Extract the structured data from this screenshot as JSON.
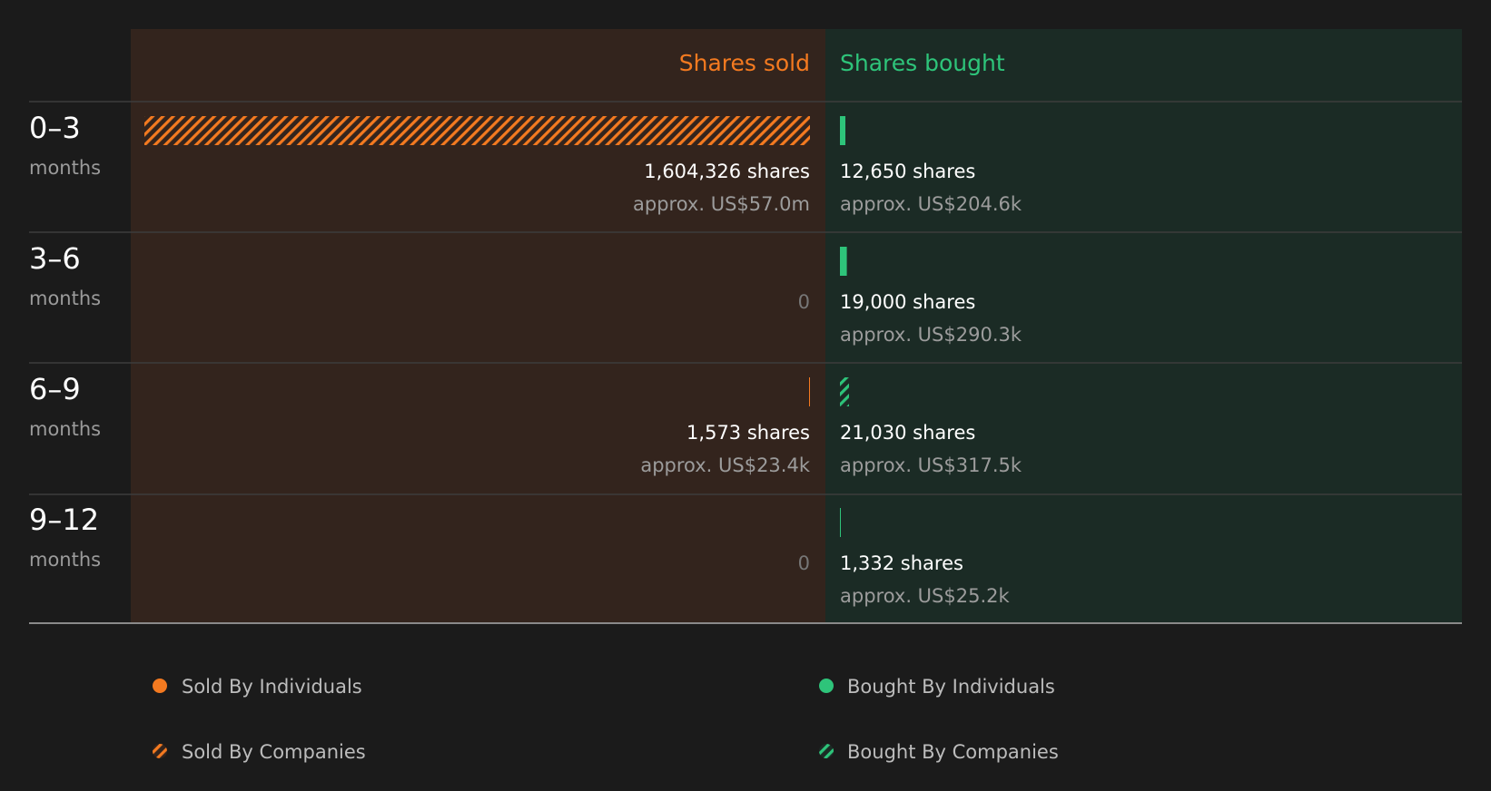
{
  "colors": {
    "background": "#1b1b1b",
    "sold_panel": "#33241d",
    "bought_panel": "#1b2b25",
    "sold_accent": "#f47a20",
    "bought_accent": "#2ec47a",
    "divider": "#3d3d3d",
    "baseline": "#8a8a8a"
  },
  "chart_data": {
    "type": "bar",
    "orientation": "horizontal-diverging",
    "headers": {
      "sold": "Shares sold",
      "bought": "Shares bought"
    },
    "unit_label": "months",
    "sold_scale_max": 1604326,
    "rows": [
      {
        "range": "0–3",
        "sold": {
          "by": "companies",
          "shares": 1604326,
          "shares_label": "1,604,326 shares",
          "approx_label": "approx. US$57.0m",
          "zero_label": ""
        },
        "bought": {
          "by": "individuals",
          "shares": 12650,
          "shares_label": "12,650 shares",
          "approx_label": "approx. US$204.6k",
          "zero_label": ""
        }
      },
      {
        "range": "3–6",
        "sold": {
          "by": "none",
          "shares": 0,
          "shares_label": "",
          "approx_label": "",
          "zero_label": "0"
        },
        "bought": {
          "by": "individuals",
          "shares": 19000,
          "shares_label": "19,000 shares",
          "approx_label": "approx. US$290.3k",
          "zero_label": ""
        }
      },
      {
        "range": "6–9",
        "sold": {
          "by": "individuals",
          "shares": 1573,
          "shares_label": "1,573 shares",
          "approx_label": "approx. US$23.4k",
          "zero_label": ""
        },
        "bought": {
          "by": "companies",
          "shares": 21030,
          "shares_label": "21,030 shares",
          "approx_label": "approx. US$317.5k",
          "zero_label": ""
        }
      },
      {
        "range": "9–12",
        "sold": {
          "by": "none",
          "shares": 0,
          "shares_label": "",
          "approx_label": "",
          "zero_label": "0"
        },
        "bought": {
          "by": "individuals",
          "shares": 1332,
          "shares_label": "1,332 shares",
          "approx_label": "approx. US$25.2k",
          "zero_label": ""
        }
      }
    ],
    "legend": [
      {
        "label": "Sold By Individuals",
        "side": "sold",
        "style": "solid"
      },
      {
        "label": "Bought By Individuals",
        "side": "bought",
        "style": "solid"
      },
      {
        "label": "Sold By Companies",
        "side": "sold",
        "style": "hatched"
      },
      {
        "label": "Bought By Companies",
        "side": "bought",
        "style": "hatched"
      }
    ]
  }
}
